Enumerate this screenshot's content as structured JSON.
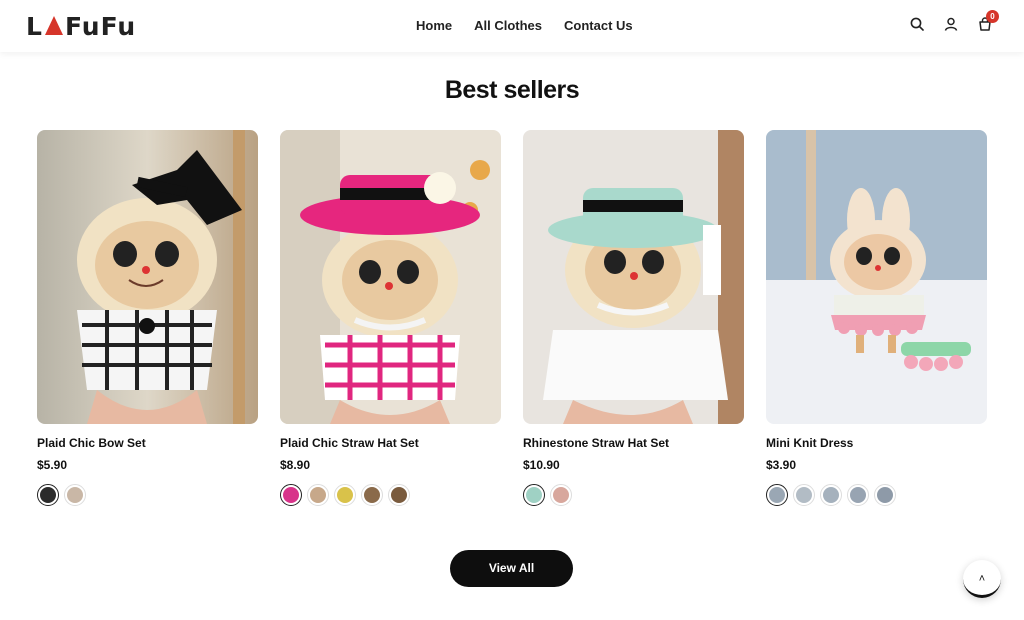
{
  "brand": {
    "logo_left": "L",
    "logo_right": "FuFu"
  },
  "nav": {
    "items": [
      "Home",
      "All Clothes",
      "Contact Us"
    ]
  },
  "header_icons": [
    "search-icon",
    "user-icon",
    "cart-icon"
  ],
  "cart": {
    "count": "0"
  },
  "section": {
    "title": "Best sellers"
  },
  "products": [
    {
      "name": "Plaid Chic Bow Set",
      "price": "$5.90",
      "swatches": [
        "#2b2b2b",
        "#c9b7a6"
      ]
    },
    {
      "name": "Plaid Chic Straw Hat Set",
      "price": "$8.90",
      "swatches": [
        "#d8338a",
        "#c7a88a",
        "#d9c24a",
        "#8a6a4a",
        "#7a5b3e"
      ]
    },
    {
      "name": "Rhinestone Straw Hat Set",
      "price": "$10.90",
      "swatches": [
        "#9fd1c4",
        "#d8a79d"
      ]
    },
    {
      "name": "Mini Knit Dress",
      "price": "$3.90",
      "swatches": [
        "#9aa7b4",
        "#b2bcc5",
        "#a5b1bd",
        "#98a4b2",
        "#8e9aa8"
      ]
    }
  ],
  "cta": {
    "view_all": "View All"
  },
  "colors": {
    "accent": "#d6352a",
    "button": "#0e0e0e"
  }
}
